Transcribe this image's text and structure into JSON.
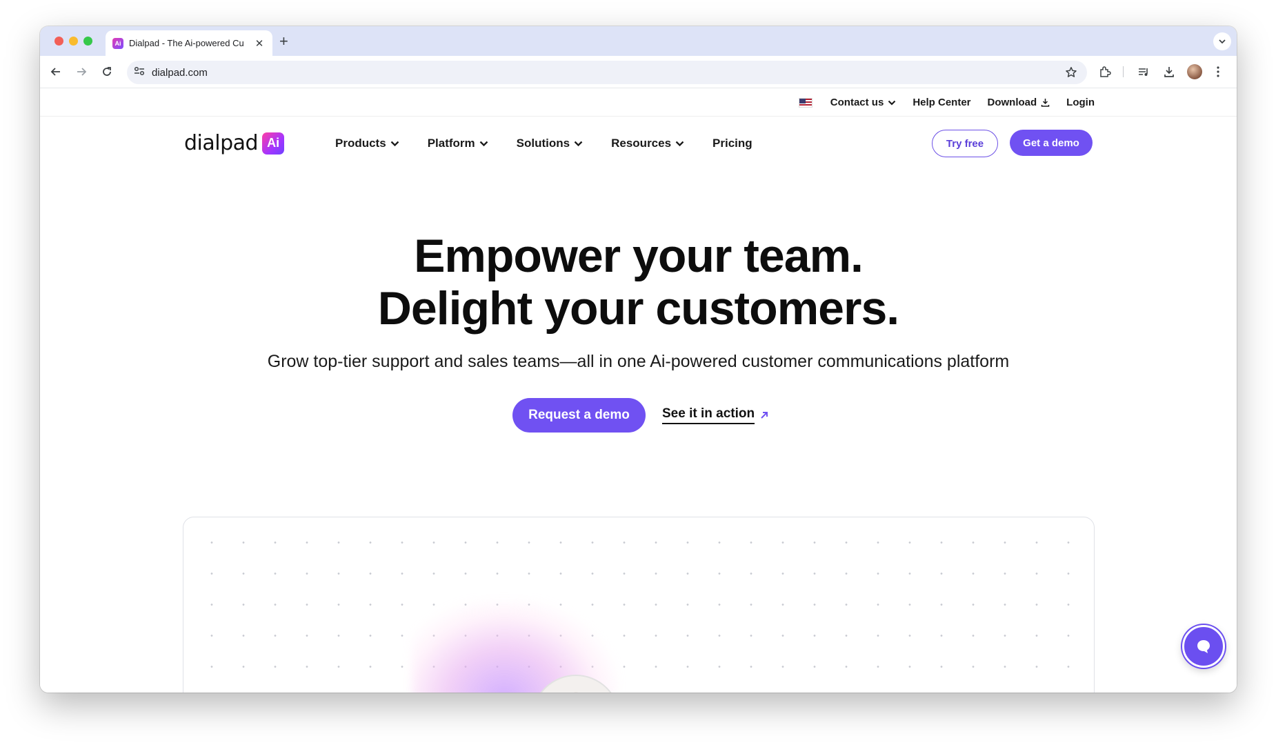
{
  "browser": {
    "tab_title": "Dialpad - The Ai-powered Cu",
    "url": "dialpad.com",
    "favicon_text": "Ai"
  },
  "utility_nav": {
    "contact": "Contact us",
    "help": "Help Center",
    "download": "Download",
    "login": "Login"
  },
  "main_nav": {
    "logo_text": "dialpad",
    "logo_mark": "Ai",
    "links": [
      "Products",
      "Platform",
      "Solutions",
      "Resources",
      "Pricing"
    ],
    "try_free": "Try free",
    "get_demo": "Get a demo"
  },
  "hero": {
    "line1": "Empower your team.",
    "line2": "Delight your customers.",
    "subtitle": "Grow top-tier support and sales teams—all in one Ai-powered customer communications platform",
    "cta_primary": "Request a demo",
    "cta_secondary": "See it in action"
  },
  "colors": {
    "brand_purple": "#7051f2",
    "tabstrip": "#dde3f7"
  }
}
